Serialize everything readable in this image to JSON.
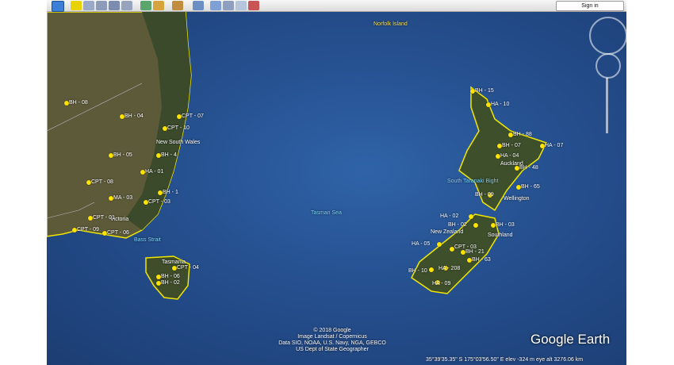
{
  "toolbar": {
    "buttons": [
      "sidebar-icon",
      "placemark-icon",
      "polygon-icon",
      "path-icon",
      "overlay-icon",
      "tour-icon",
      "historical-imagery-icon",
      "sun-icon",
      "planets-icon",
      "ruler-icon",
      "email-icon",
      "print-icon",
      "save-image-icon",
      "maps-icon"
    ],
    "sign_in": "Sign in"
  },
  "map": {
    "place_labels": [
      {
        "text": "Norfolk Island",
        "color": "yel"
      },
      {
        "text": "New South Wales",
        "color": "white"
      },
      {
        "text": "Victoria",
        "color": "white"
      },
      {
        "text": "Bass Strait",
        "color": "cyan"
      },
      {
        "text": "Tasmania",
        "color": "white"
      },
      {
        "text": "Tasman Sea",
        "color": "cyan"
      },
      {
        "text": "Auckland",
        "color": "white"
      },
      {
        "text": "South Taranaki Bight",
        "color": "cyan"
      },
      {
        "text": "Wellington",
        "color": "white"
      },
      {
        "text": "New Zealand",
        "color": "white"
      },
      {
        "text": "Southland",
        "color": "white"
      }
    ],
    "markers": [
      "BH - 08",
      "BH - 04",
      "CPT - 07",
      "CPT - 10",
      "BH - 05",
      "BH - 4",
      "HA - 01",
      "CPT - 08",
      "MA - 03",
      "BH - 1",
      "CPT - 03",
      "CPT - 01",
      "CPT - 09",
      "CPT - 06",
      "CPT - 04",
      "BH - 06",
      "BH - 02",
      "BH - 15",
      "HA - 10",
      "BH - 88",
      "BH - 07",
      "HA - 07",
      "HA - 04",
      "BH - 48",
      "BH - 65",
      "BH - 09",
      "HA - 02",
      "BH - 02",
      "BH - 03",
      "HA - 05",
      "BH - 21",
      "CPT - 03",
      "BH - 63",
      "BH - 10",
      "HA - 208",
      "HA - 09"
    ]
  },
  "credits": [
    "© 2018 Google",
    "Image Landsat / Copernicus",
    "Data SIO, NOAA, U.S. Navy, NGA, GEBCO",
    "US Dept of State Geographer"
  ],
  "status": "35°39'35.35\" S  175°03'56.50\" E  elev -324 m          eye alt 3276.06 km",
  "logo": "Google Earth",
  "colors": {
    "ocean": "#254f8e",
    "land": "#3e4f2c",
    "marker": "#ffe400",
    "coast": "#f0e600"
  }
}
